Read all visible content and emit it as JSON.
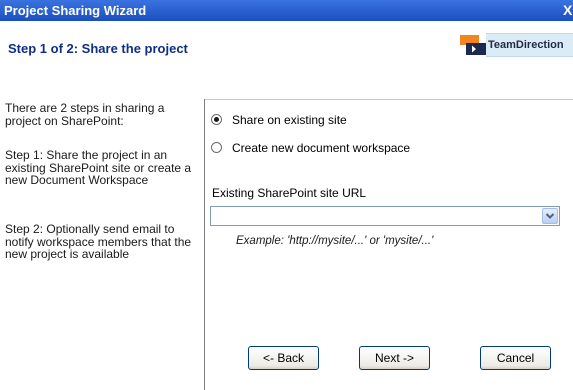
{
  "window": {
    "title": "Project Sharing Wizard",
    "close_glyph": "X"
  },
  "header": {
    "step_title": "Step 1 of 2:  Share the project",
    "logo_text": "TeamDirection",
    "logo_colors": {
      "orange": "#f4841f",
      "navy": "#1b2a4e"
    }
  },
  "instructions": {
    "intro": "There are 2 steps in sharing a project on SharePoint:",
    "step1": "Step 1: Share the project in an existing SharePoint site or create a new Document Workspace",
    "step2": "Step 2: Optionally send email to notify workspace members that the new project is available"
  },
  "options": {
    "existing_site_label": "Share on existing site",
    "new_workspace_label": "Create new document workspace",
    "selected": "existing_site"
  },
  "url_field": {
    "label": "Existing SharePoint site URL",
    "value": "",
    "example": "Example:  'http://mysite/...' or 'mysite/...'"
  },
  "buttons": {
    "back": "<- Back",
    "next": "Next ->",
    "cancel": "Cancel"
  },
  "colors": {
    "titlebar": "#2156c9",
    "step_title": "#0f2e86"
  }
}
